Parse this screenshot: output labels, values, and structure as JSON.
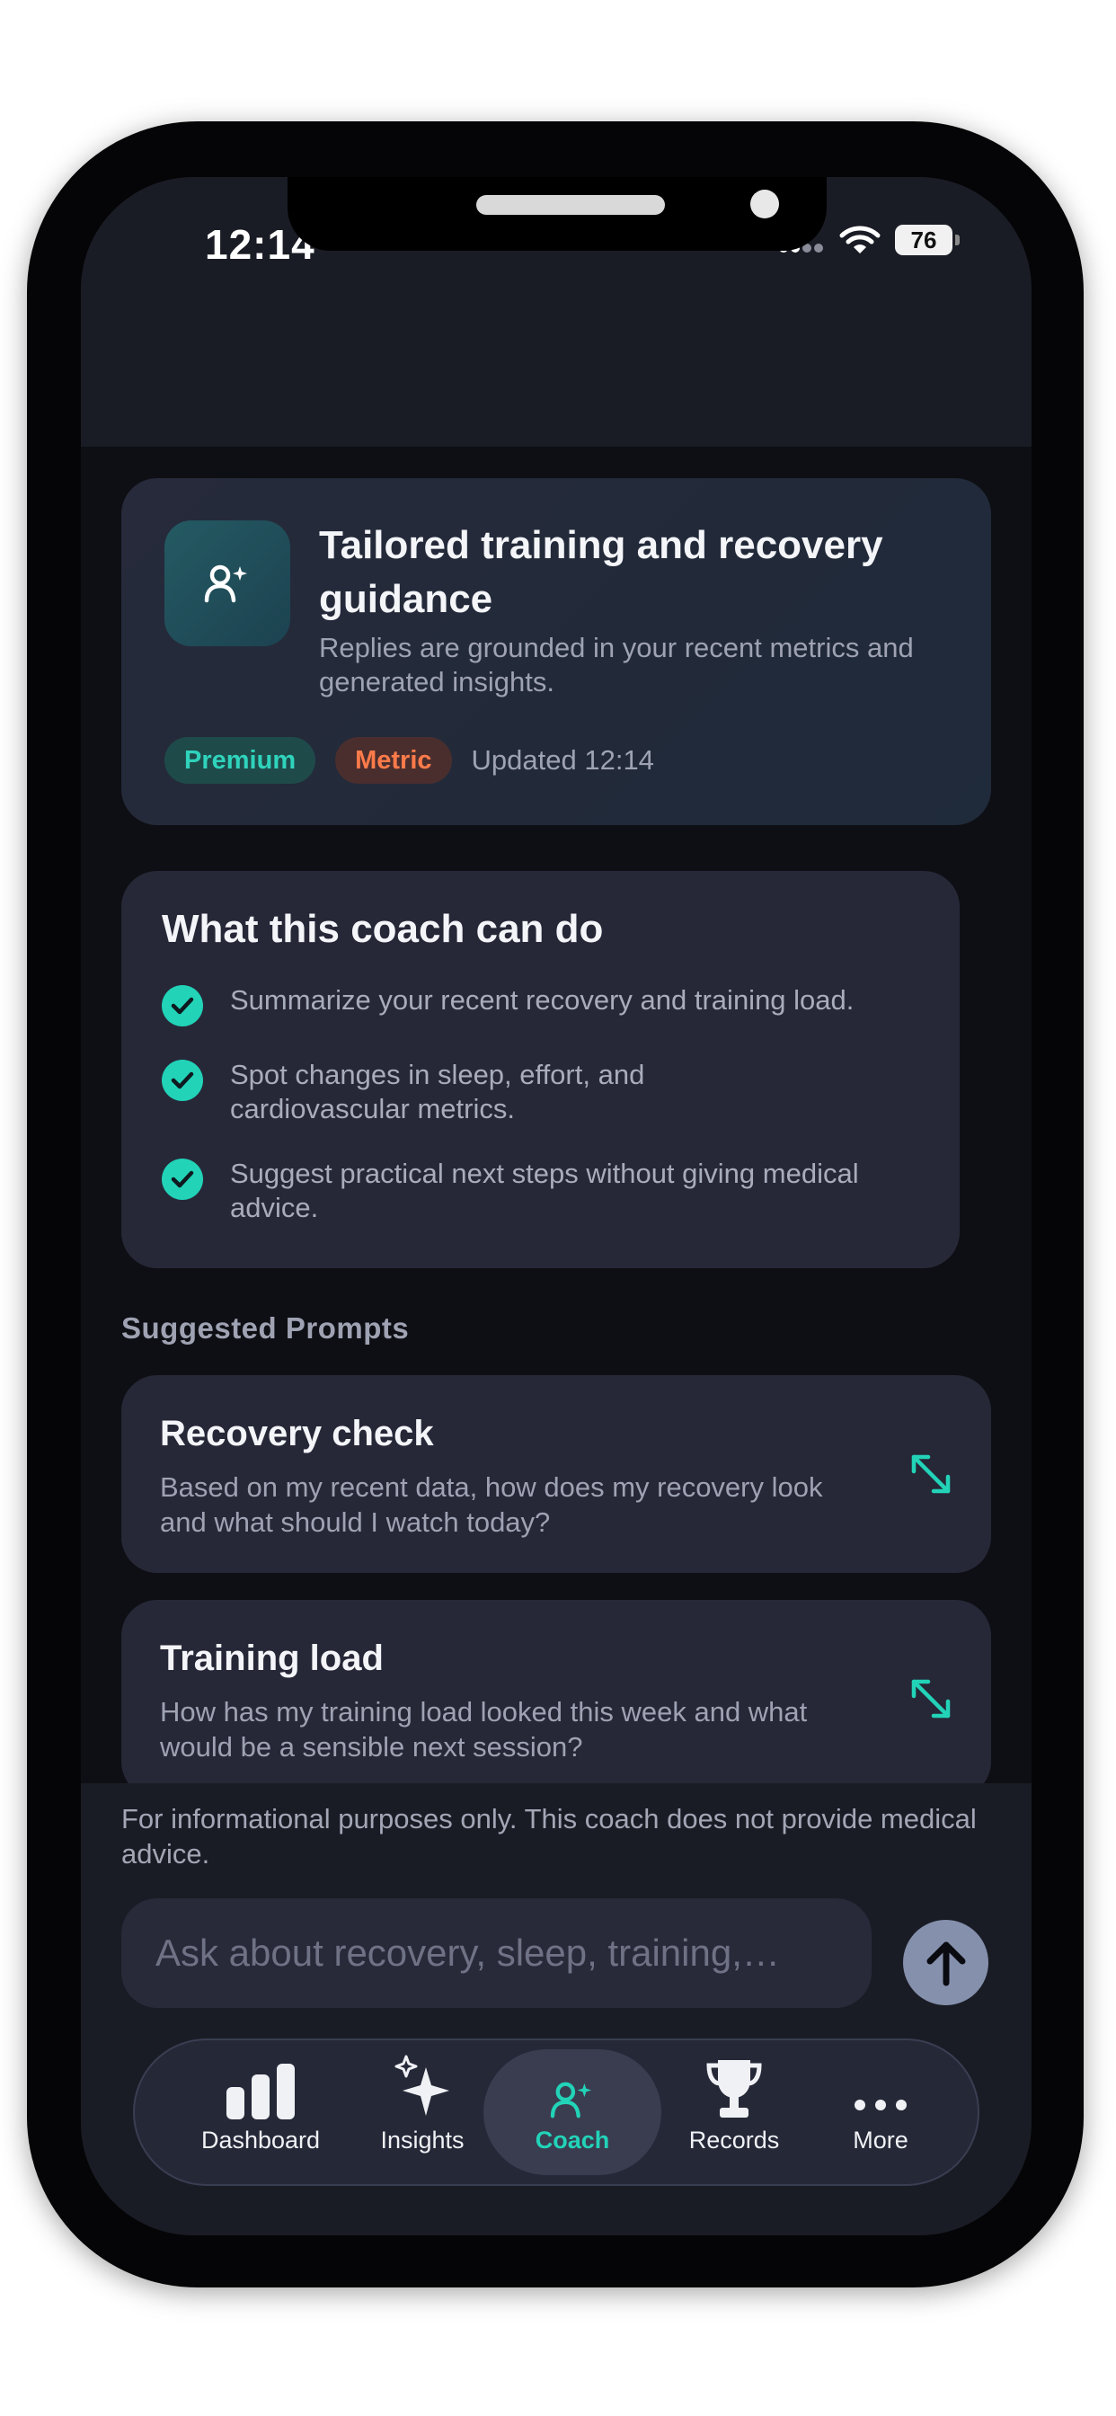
{
  "status_bar": {
    "time": "12:14",
    "battery": "76"
  },
  "hero": {
    "icon": "person-sparkle-icon",
    "title": "Tailored training and recovery guidance",
    "subtitle": "Replies are grounded in your recent metrics and generated insights.",
    "chips": {
      "premium": "Premium",
      "metric": "Metric",
      "updated": "Updated 12:14"
    }
  },
  "capabilities": {
    "title": "What this coach can do",
    "items": [
      "Summarize your recent recovery and training load.",
      "Spot changes in sleep, effort, and cardiovascular metrics.",
      "Suggest practical next steps without giving medical advice."
    ]
  },
  "suggested": {
    "label": "Suggested Prompts",
    "prompts": [
      {
        "title": "Recovery check",
        "body": "Based on my recent data, how does my recovery look and what should I watch today?"
      },
      {
        "title": "Training load",
        "body": "How has my training load looked this week and what would be a sensible next session?"
      }
    ]
  },
  "footer": {
    "disclaimer": "For informational purposes only. This coach does not provide medical advice.",
    "input_placeholder": "Ask about recovery, sleep, training,…"
  },
  "tabs": [
    {
      "label": "Dashboard",
      "icon": "bar-chart-icon",
      "active": false
    },
    {
      "label": "Insights",
      "icon": "sparkles-icon",
      "active": false
    },
    {
      "label": "Coach",
      "icon": "person-sparkle-icon",
      "active": true
    },
    {
      "label": "Records",
      "icon": "trophy-icon",
      "active": false
    },
    {
      "label": "More",
      "icon": "more-dots-icon",
      "active": false
    }
  ],
  "colors": {
    "accent": "#22d3b8",
    "metric": "#ff7b4a",
    "card": "#262838",
    "background": "#0e0f14"
  }
}
